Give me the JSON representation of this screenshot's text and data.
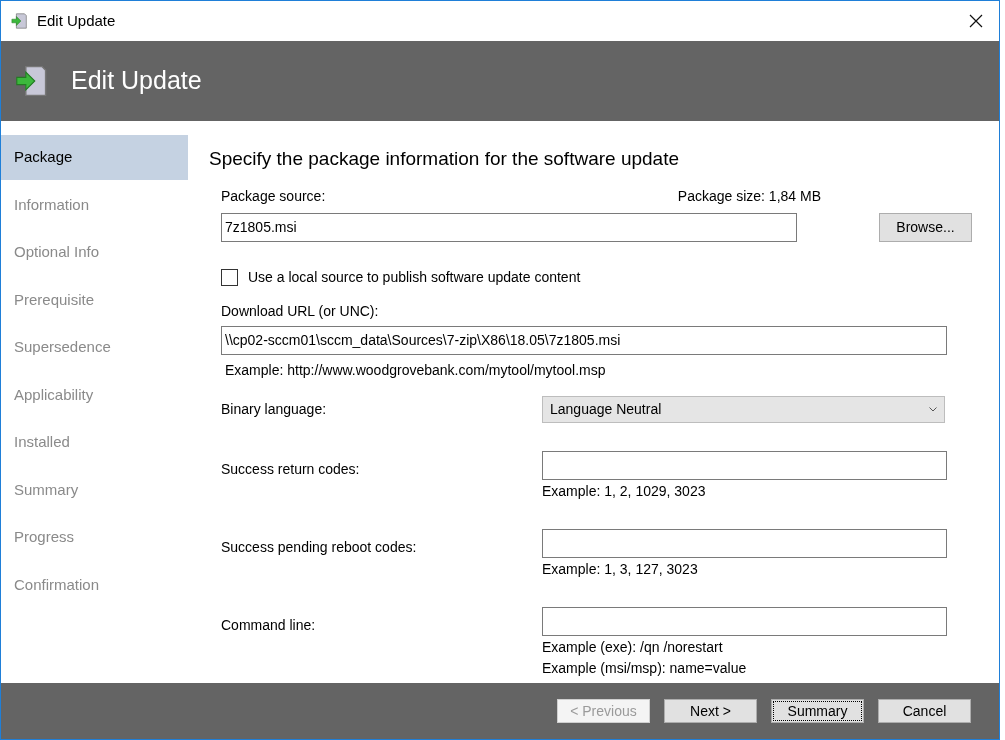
{
  "window": {
    "title": "Edit Update"
  },
  "header": {
    "title": "Edit Update"
  },
  "sidebar": {
    "items": [
      {
        "label": "Package",
        "selected": true
      },
      {
        "label": "Information",
        "selected": false
      },
      {
        "label": "Optional Info",
        "selected": false
      },
      {
        "label": "Prerequisite",
        "selected": false
      },
      {
        "label": "Supersedence",
        "selected": false
      },
      {
        "label": "Applicability",
        "selected": false
      },
      {
        "label": "Installed",
        "selected": false
      },
      {
        "label": "Summary",
        "selected": false
      },
      {
        "label": "Progress",
        "selected": false
      },
      {
        "label": "Confirmation",
        "selected": false
      }
    ]
  },
  "heading": "Specify the package information for the software update",
  "package_source": {
    "label": "Package source:",
    "size": "Package size: 1,84 MB",
    "value": "7z1805.msi",
    "browse": "Browse..."
  },
  "local_source": {
    "label": "Use a local source to publish software update content",
    "checked": false
  },
  "download": {
    "label": "Download URL (or UNC):",
    "value": "\\\\cp02-sccm01\\sccm_data\\Sources\\7-zip\\X86\\18.05\\7z1805.msi",
    "example": "Example: http://www.woodgrovebank.com/mytool/mytool.msp"
  },
  "binary_language": {
    "label": "Binary language:",
    "value": "Language Neutral"
  },
  "fields": [
    {
      "label": "Success return codes:",
      "examples": [
        "Example: 1, 2, 1029, 3023"
      ]
    },
    {
      "label": "Success pending reboot codes:",
      "examples": [
        "Example: 1, 3, 127, 3023"
      ]
    },
    {
      "label": "Command line:",
      "examples": [
        "Example (exe): /qn /norestart",
        "Example (msi/msp): name=value"
      ]
    }
  ],
  "buttons": [
    {
      "label": "< Previous",
      "disabled": true,
      "focused": false
    },
    {
      "label": "Next >",
      "disabled": false,
      "focused": false
    },
    {
      "label": "Summary",
      "disabled": false,
      "focused": true
    },
    {
      "label": "Cancel",
      "disabled": false,
      "focused": false
    }
  ]
}
